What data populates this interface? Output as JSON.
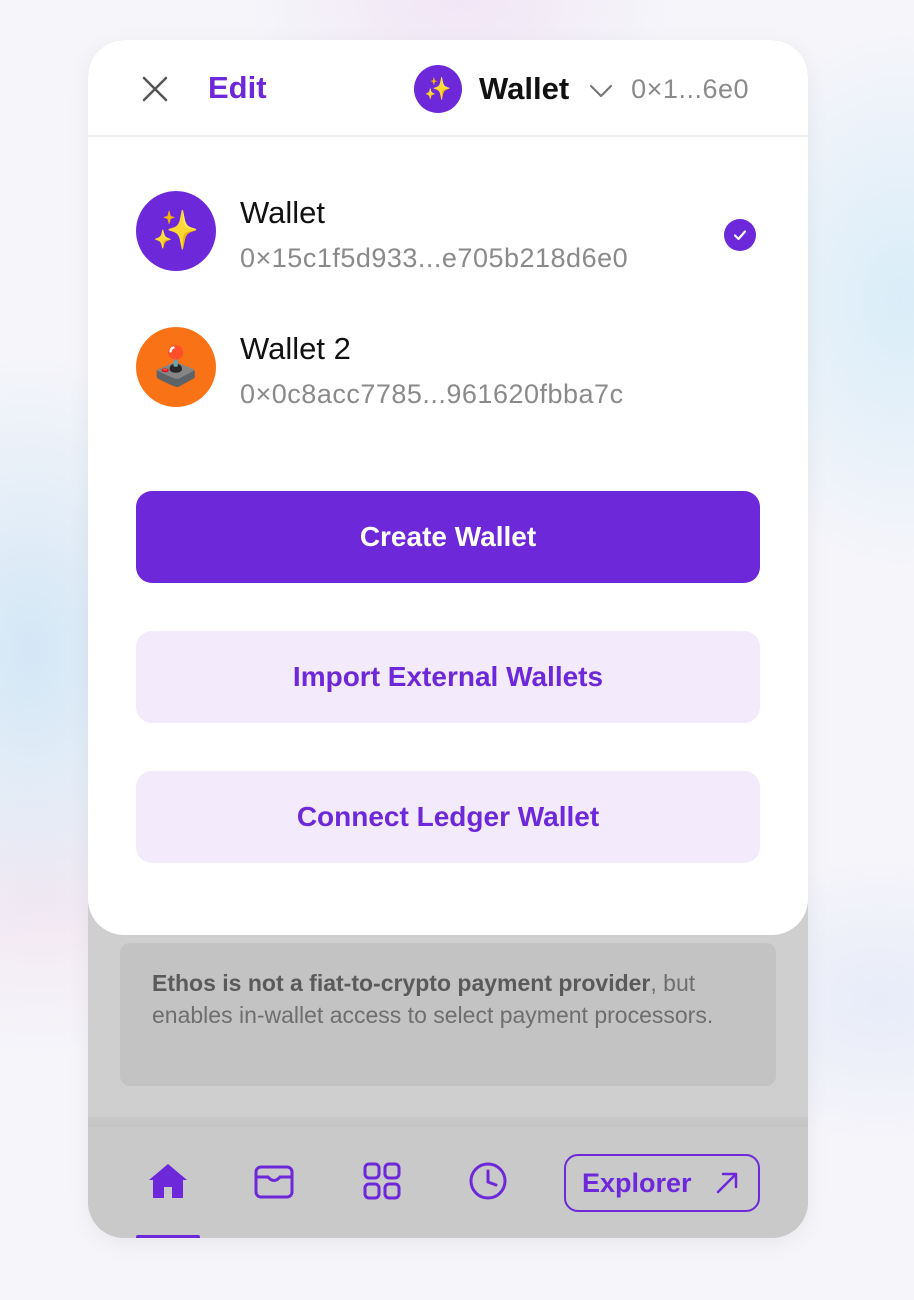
{
  "header": {
    "edit_label": "Edit",
    "current_wallet": {
      "name": "Wallet",
      "address_short": "0×1...6e0",
      "avatar_emoji": "✨"
    }
  },
  "wallets": [
    {
      "name": "Wallet",
      "address": "0×15c1f5d933...e705b218d6e0",
      "avatar_emoji": "✨",
      "avatar_color": "#6d28d9",
      "selected": true
    },
    {
      "name": "Wallet 2",
      "address": "0×0c8acc7785...961620fbba7c",
      "avatar_emoji": "🕹️",
      "avatar_color": "#f97316",
      "selected": false
    }
  ],
  "actions": {
    "create_label": "Create Wallet",
    "import_label": "Import External Wallets",
    "ledger_label": "Connect Ledger Wallet"
  },
  "info_box": {
    "bold_text": "Ethos is not a fiat-to-crypto payment provider",
    "rest_text": ", but enables in-wallet access to select payment processors."
  },
  "bottom_nav": {
    "items": [
      {
        "icon": "home-icon",
        "active": true
      },
      {
        "icon": "wallet-icon",
        "active": false
      },
      {
        "icon": "apps-grid-icon",
        "active": false
      },
      {
        "icon": "history-clock-icon",
        "active": false
      }
    ],
    "explorer_label": "Explorer"
  },
  "colors": {
    "accent": "#6d28d9",
    "accent_light": "#f3eafc",
    "avatar_orange": "#f97316"
  }
}
